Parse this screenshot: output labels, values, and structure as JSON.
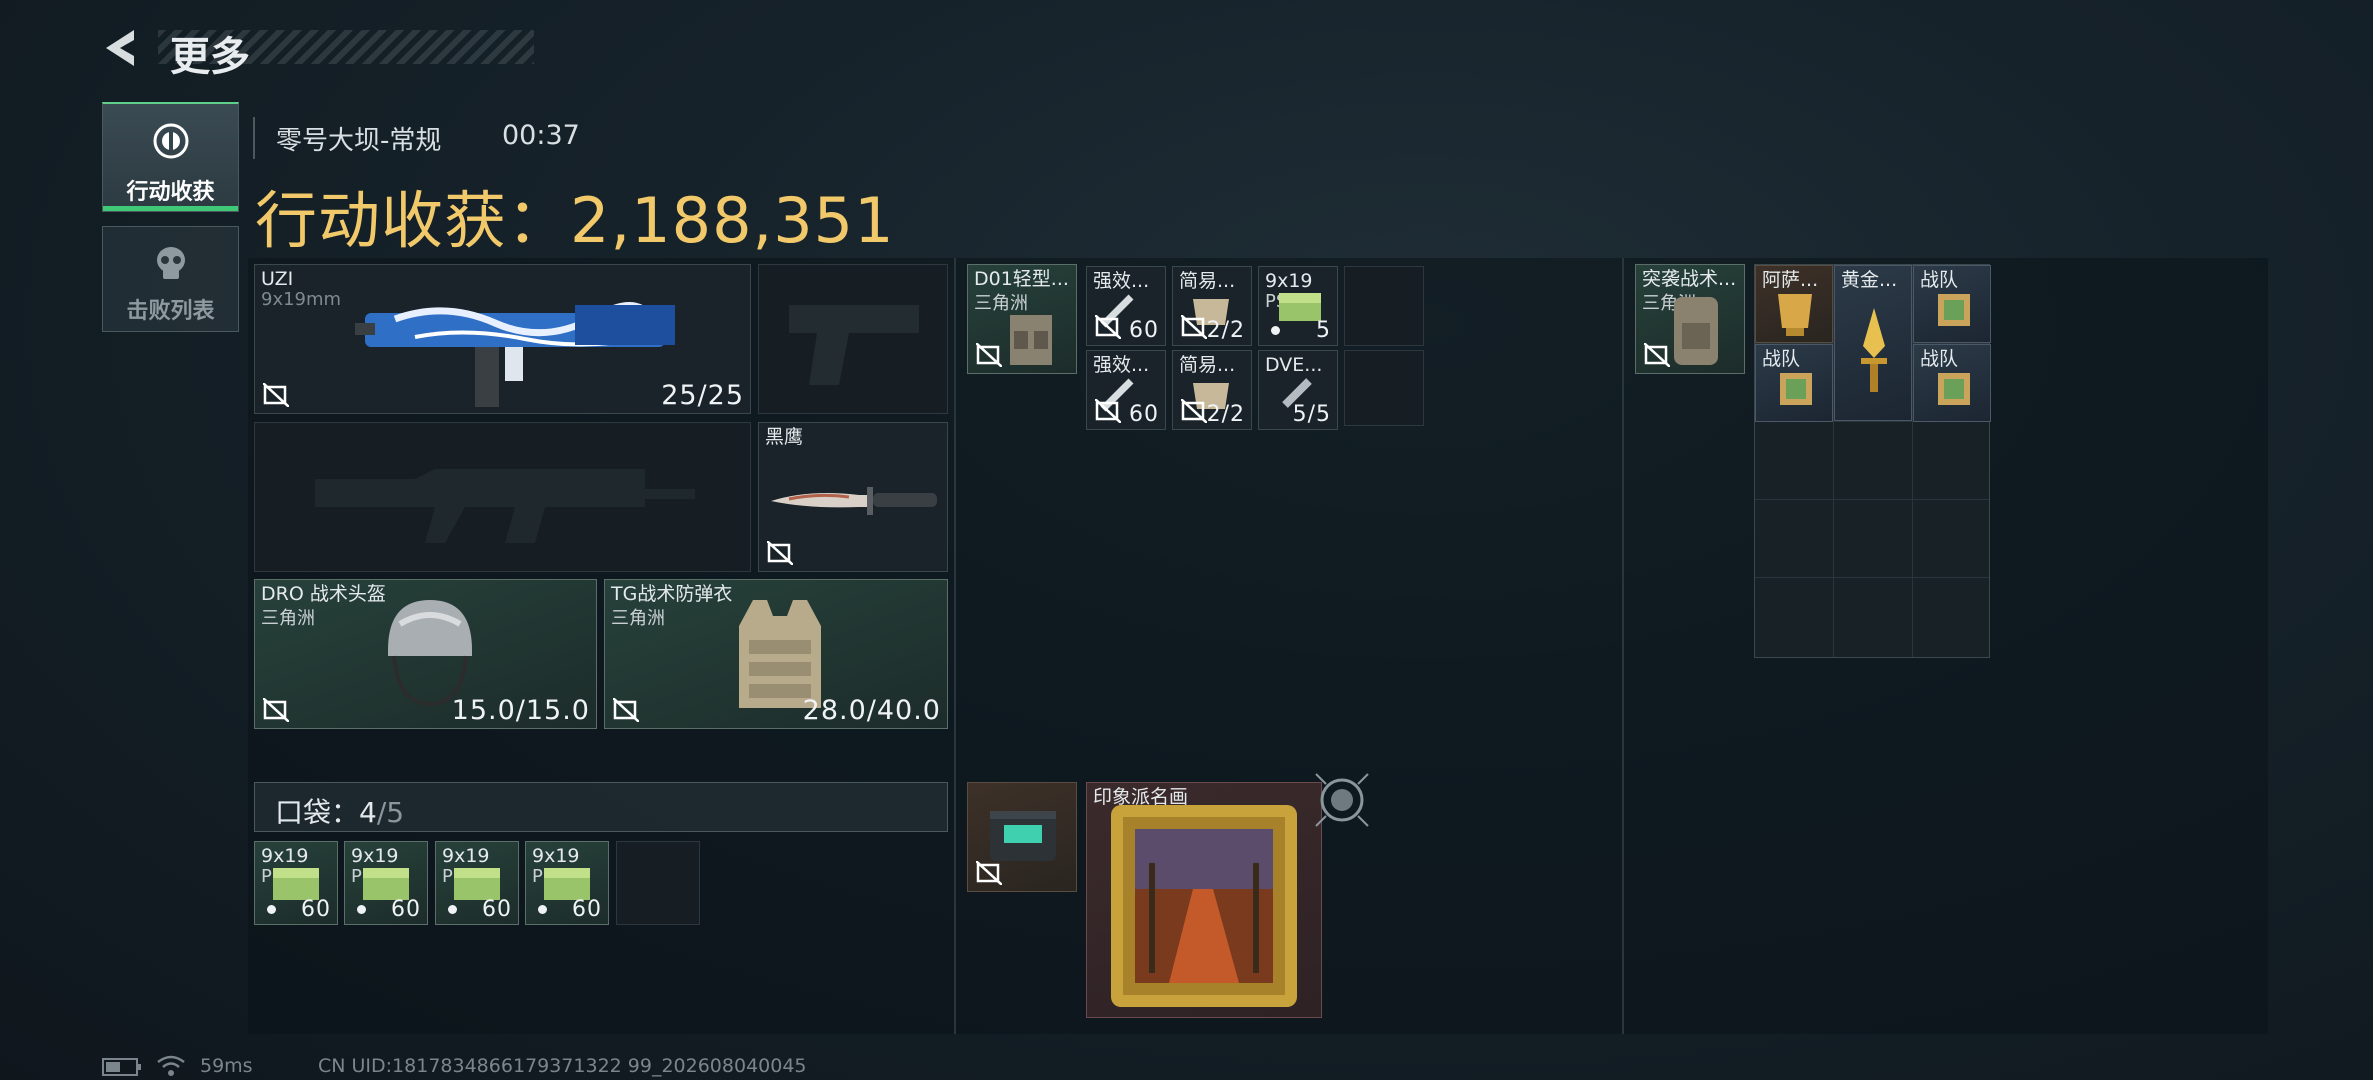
{
  "header": {
    "title": "更多"
  },
  "sidebar": {
    "tabs": [
      {
        "label": "行动收获",
        "active": true,
        "icon": "loot-icon"
      },
      {
        "label": "击败列表",
        "active": false,
        "icon": "skull-icon"
      }
    ]
  },
  "raid": {
    "map": "零号大坝-常规",
    "time": "00:37",
    "harvest_label": "行动收获：",
    "harvest_value": "2,188,351"
  },
  "equipment": {
    "primary": {
      "name": "UZI",
      "caliber": "9x19mm",
      "ammo": "25/25"
    },
    "melee": {
      "name": "黑鹰"
    },
    "helmet": {
      "name": "DRO 战术头盔",
      "origin": "三角洲",
      "durability": "15.0/15.0"
    },
    "armor": {
      "name": "TG战术防弹衣",
      "origin": "三角洲",
      "durability": "28.0/40.0"
    }
  },
  "pocket": {
    "label": "口袋：",
    "used": "4",
    "capacity": "/5",
    "items": [
      {
        "name": "9x19",
        "sub": "PSO",
        "count": "60"
      },
      {
        "name": "9x19",
        "sub": "PSO",
        "count": "60"
      },
      {
        "name": "9x19",
        "sub": "PSO",
        "count": "60"
      },
      {
        "name": "9x19",
        "sub": "PSO",
        "count": "60"
      }
    ]
  },
  "chest_rig": {
    "name": "D01轻型...",
    "origin": "三角洲",
    "items": [
      {
        "name": "强效...",
        "count": "60"
      },
      {
        "name": "简易...",
        "count": "2/2"
      },
      {
        "name": "9x19",
        "sub": "PSO",
        "count": "5"
      },
      {
        "name": "强效...",
        "count": "60"
      },
      {
        "name": "简易...",
        "count": "2/2"
      },
      {
        "name": "DVE...",
        "count": "5/5"
      }
    ]
  },
  "case": {
    "painting_name": "印象派名画"
  },
  "backpack": {
    "name": "突袭战术...",
    "origin": "三角洲",
    "items": [
      {
        "name": "阿萨..."
      },
      {
        "name": "黄金..."
      },
      {
        "name": "战队"
      },
      {
        "name": "战队"
      },
      {
        "name": "战队"
      }
    ]
  },
  "status": {
    "ping": "59ms",
    "uid": "CN UID:1817834866179371322 99_202608040045"
  }
}
